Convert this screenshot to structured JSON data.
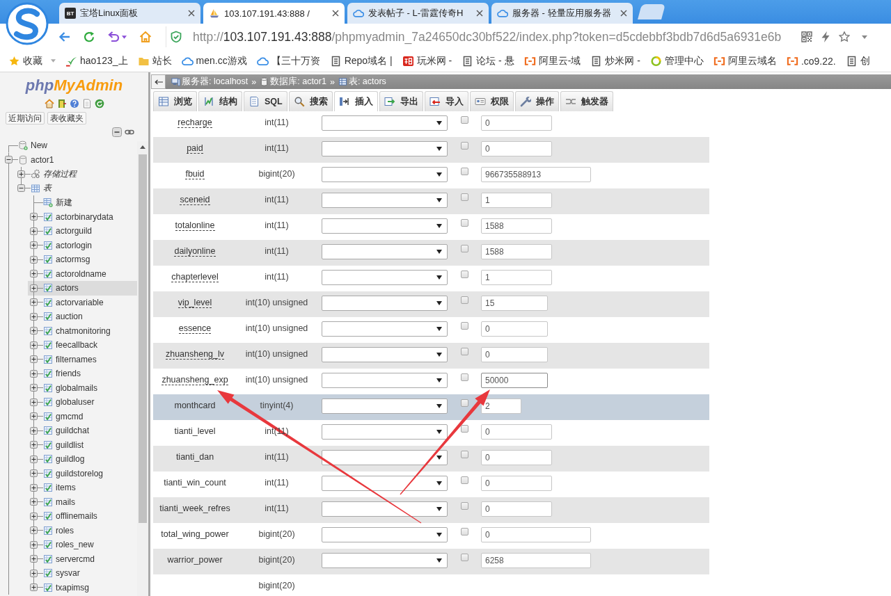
{
  "browser": {
    "tabs": [
      {
        "kind": "bt",
        "badge": "BT",
        "title": "宝塔Linux面板",
        "selected": false
      },
      {
        "kind": "sail",
        "title": "103.107.191.43:888 /",
        "selected": true
      },
      {
        "kind": "cloud",
        "title": "发表帖子 - L-雷霆传奇H",
        "selected": false
      },
      {
        "kind": "cloud",
        "title": "服务器 - 轻量应用服务器",
        "selected": false
      }
    ],
    "address": {
      "scheme": "http://",
      "host": "103.107.191.43:888",
      "path": "/phpmyadmin_7a24650dc30bf522/index.php?token=d5cdebbf3bdb7d6d5a6931e6b"
    },
    "bookmarks": [
      {
        "kind": "star",
        "label": "收藏"
      },
      {
        "kind": "leaf",
        "label": "hao123_上"
      },
      {
        "kind": "folder",
        "label": "站长"
      },
      {
        "kind": "cloud",
        "label": "men.cc游戏"
      },
      {
        "kind": "cloud",
        "label": "【三十万资"
      },
      {
        "kind": "doc",
        "label": "Repo域名 |"
      },
      {
        "kind": "square",
        "label": "玩米网 -"
      },
      {
        "kind": "doc",
        "label": "论坛 - 悬"
      },
      {
        "kind": "bracket",
        "label": "阿里云-域"
      },
      {
        "kind": "doc",
        "label": "炒米网 -"
      },
      {
        "kind": "ring",
        "label": "管理中心"
      },
      {
        "kind": "bracket",
        "label": "阿里云域名"
      },
      {
        "kind": "bracket",
        "label": ".co9.22."
      },
      {
        "kind": "doc",
        "label": "创"
      }
    ]
  },
  "sidebar": {
    "logo": {
      "first": "php",
      "second": "MyAdmin"
    },
    "quick_buttons": [
      "近期访问",
      "表收藏夹"
    ],
    "tree": [
      {
        "kind": "new",
        "label": "New"
      },
      {
        "kind": "database",
        "label": "actor1",
        "expanded": true,
        "children": [
          {
            "kind": "routines",
            "label": "存储过程",
            "expanded": false
          },
          {
            "kind": "tables",
            "label": "表",
            "expanded": true,
            "children": [
              {
                "kind": "new_table",
                "label": "新建",
                "selected": false
              },
              {
                "kind": "table",
                "label": "actorbinarydata",
                "expanded": false,
                "selected": false
              },
              {
                "kind": "table",
                "label": "actorguild",
                "expanded": false,
                "selected": false
              },
              {
                "kind": "table",
                "label": "actorlogin",
                "expanded": false,
                "selected": false
              },
              {
                "kind": "table",
                "label": "actormsg",
                "expanded": false,
                "selected": false
              },
              {
                "kind": "table",
                "label": "actoroldname",
                "expanded": false,
                "selected": false
              },
              {
                "kind": "table",
                "label": "actors",
                "expanded": false,
                "selected": true
              },
              {
                "kind": "table",
                "label": "actorvariable",
                "expanded": false,
                "selected": false
              },
              {
                "kind": "table",
                "label": "auction",
                "expanded": false,
                "selected": false
              },
              {
                "kind": "table",
                "label": "chatmonitoring",
                "expanded": false,
                "selected": false
              },
              {
                "kind": "table",
                "label": "feecallback",
                "expanded": false,
                "selected": false
              },
              {
                "kind": "table",
                "label": "filternames",
                "expanded": false,
                "selected": false
              },
              {
                "kind": "table",
                "label": "friends",
                "expanded": false,
                "selected": false
              },
              {
                "kind": "table",
                "label": "globalmails",
                "expanded": false,
                "selected": false
              },
              {
                "kind": "table",
                "label": "globaluser",
                "expanded": false,
                "selected": false
              },
              {
                "kind": "table",
                "label": "gmcmd",
                "expanded": false,
                "selected": false
              },
              {
                "kind": "table",
                "label": "guildchat",
                "expanded": false,
                "selected": false
              },
              {
                "kind": "table",
                "label": "guildlist",
                "expanded": false,
                "selected": false
              },
              {
                "kind": "table",
                "label": "guildlog",
                "expanded": false,
                "selected": false
              },
              {
                "kind": "table",
                "label": "guildstorelog",
                "expanded": false,
                "selected": false
              },
              {
                "kind": "table",
                "label": "items",
                "expanded": false,
                "selected": false
              },
              {
                "kind": "table",
                "label": "mails",
                "expanded": false,
                "selected": false
              },
              {
                "kind": "table",
                "label": "offlinemails",
                "expanded": false,
                "selected": false
              },
              {
                "kind": "table",
                "label": "roles",
                "expanded": false,
                "selected": false
              },
              {
                "kind": "table",
                "label": "roles_new",
                "expanded": false,
                "selected": false
              },
              {
                "kind": "table",
                "label": "servercmd",
                "expanded": false,
                "selected": false
              },
              {
                "kind": "table",
                "label": "sysvar",
                "expanded": false,
                "selected": false
              },
              {
                "kind": "table",
                "label": "txapimsg",
                "expanded": false,
                "selected": false
              }
            ]
          }
        ]
      }
    ]
  },
  "breadcrumb": [
    {
      "kind": "server",
      "label": "服务器: localhost",
      "separator": "»"
    },
    {
      "kind": "database",
      "label": "数据库: actor1",
      "separator": "»"
    },
    {
      "kind": "table",
      "label": "表: actors"
    }
  ],
  "tabs": [
    {
      "kind": "browse",
      "label": "浏览",
      "selected": false
    },
    {
      "kind": "structure",
      "label": "结构",
      "selected": false
    },
    {
      "kind": "sql",
      "label": "SQL",
      "selected": false
    },
    {
      "kind": "search",
      "label": "搜索",
      "selected": false
    },
    {
      "kind": "insert",
      "label": "插入",
      "selected": true
    },
    {
      "kind": "export",
      "label": "导出",
      "selected": false
    },
    {
      "kind": "import",
      "label": "导入",
      "selected": false
    },
    {
      "kind": "privileges",
      "label": "权限",
      "selected": false
    },
    {
      "kind": "operations",
      "label": "操作",
      "selected": false
    },
    {
      "kind": "triggers",
      "label": "触发器",
      "selected": false
    }
  ],
  "insert_form": {
    "rows": [
      {
        "name": "recharge",
        "type": "int(11)",
        "kind": "int",
        "underlined": true,
        "null_checked": false,
        "value": "0",
        "focused": false,
        "highlighted": false
      },
      {
        "name": "paid",
        "type": "int(11)",
        "kind": "int",
        "underlined": true,
        "null_checked": false,
        "value": "0",
        "focused": false,
        "highlighted": false
      },
      {
        "name": "fbuid",
        "type": "bigint(20)",
        "kind": "bigint",
        "underlined": true,
        "null_checked": false,
        "value": "966735588913",
        "focused": false,
        "highlighted": false
      },
      {
        "name": "sceneid",
        "type": "int(11)",
        "kind": "int",
        "underlined": true,
        "null_checked": false,
        "value": "1",
        "focused": false,
        "highlighted": false
      },
      {
        "name": "totalonline",
        "type": "int(11)",
        "kind": "int",
        "underlined": true,
        "null_checked": false,
        "value": "1588",
        "focused": false,
        "highlighted": false
      },
      {
        "name": "dailyonline",
        "type": "int(11)",
        "kind": "int",
        "underlined": true,
        "null_checked": false,
        "value": "1588",
        "focused": false,
        "highlighted": false
      },
      {
        "name": "chapterlevel",
        "type": "int(11)",
        "kind": "int",
        "underlined": true,
        "null_checked": false,
        "value": "1",
        "focused": false,
        "highlighted": false
      },
      {
        "name": "vip_level",
        "type": "int(10) unsigned",
        "kind": "unsigned",
        "underlined": true,
        "null_checked": false,
        "value": "15",
        "focused": false,
        "highlighted": false
      },
      {
        "name": "essence",
        "type": "int(10) unsigned",
        "kind": "unsigned",
        "underlined": true,
        "null_checked": false,
        "value": "0",
        "focused": false,
        "highlighted": false
      },
      {
        "name": "zhuansheng_lv",
        "type": "int(10) unsigned",
        "kind": "unsigned",
        "underlined": true,
        "null_checked": false,
        "value": "0",
        "focused": false,
        "highlighted": false
      },
      {
        "name": "zhuansheng_exp",
        "type": "int(10) unsigned",
        "kind": "unsigned",
        "underlined": true,
        "null_checked": false,
        "value": "50000",
        "focused": true,
        "highlighted": false
      },
      {
        "name": "monthcard",
        "type": "tinyint(4)",
        "kind": "tinyint",
        "underlined": false,
        "null_checked": false,
        "value": "2",
        "focused": false,
        "highlighted": true
      },
      {
        "name": "tianti_level",
        "type": "int(11)",
        "kind": "int",
        "underlined": false,
        "null_checked": false,
        "value": "0",
        "focused": false,
        "highlighted": false
      },
      {
        "name": "tianti_dan",
        "type": "int(11)",
        "kind": "int",
        "underlined": false,
        "null_checked": false,
        "value": "0",
        "focused": false,
        "highlighted": false
      },
      {
        "name": "tianti_win_count",
        "type": "int(11)",
        "kind": "int",
        "underlined": false,
        "null_checked": false,
        "value": "0",
        "focused": false,
        "highlighted": false
      },
      {
        "name": "tianti_week_refres",
        "type": "int(11)",
        "kind": "int",
        "underlined": false,
        "null_checked": false,
        "value": "0",
        "focused": false,
        "highlighted": false
      },
      {
        "name": "total_wing_power",
        "type": "bigint(20)",
        "kind": "bigint",
        "underlined": false,
        "null_checked": false,
        "value": "0",
        "focused": false,
        "highlighted": false
      },
      {
        "name": "warrior_power",
        "type": "bigint(20)",
        "kind": "bigint",
        "underlined": false,
        "null_checked": false,
        "value": "6258",
        "focused": false,
        "highlighted": false
      },
      {
        "type": "bigint(20)"
      }
    ]
  }
}
